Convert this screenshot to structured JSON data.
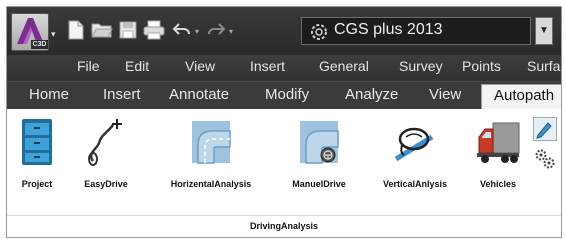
{
  "quick_access": {
    "app_badge": "C3D",
    "workspace": "CGS plus 2013"
  },
  "menu": [
    "File",
    "Edit",
    "View",
    "Insert",
    "General",
    "Survey",
    "Points",
    "Surfa"
  ],
  "tabs": [
    "Home",
    "Insert",
    "Annotate",
    "Modify",
    "Analyze",
    "View",
    "Autopath"
  ],
  "active_tab": "Autopath",
  "panel": {
    "title": "DrivingAnalysis",
    "buttons": [
      {
        "label": "Project",
        "icon": "project-cabinet-icon"
      },
      {
        "label": "EasyDrive",
        "icon": "easydrive-path-icon"
      },
      {
        "label": "HorizentalAnalysis",
        "icon": "horizontal-analysis-icon"
      },
      {
        "label": "ManuelDrive",
        "icon": "manual-drive-steering-icon"
      },
      {
        "label": "VerticalAnlysis",
        "icon": "vertical-analysis-icon"
      },
      {
        "label": "Vehicles",
        "icon": "truck-icon"
      }
    ],
    "small_buttons": [
      "edit-pencil-icon",
      "settings-gears-icon"
    ]
  },
  "colors": {
    "title_bar": "#2a2a2a",
    "active_tab_bg": "#f3f3f3",
    "accent_blue": "#5a9fd4"
  }
}
